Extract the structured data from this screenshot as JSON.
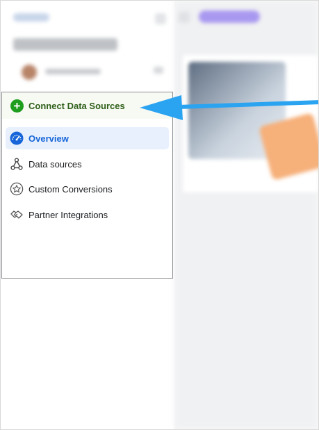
{
  "menu": {
    "connect_label": "Connect Data Sources",
    "items": [
      {
        "label": "Overview",
        "icon": "dashboard-icon",
        "active": true
      },
      {
        "label": "Data sources",
        "icon": "data-sources-icon",
        "active": false
      },
      {
        "label": "Custom Conversions",
        "icon": "star-circle-icon",
        "active": false
      },
      {
        "label": "Partner Integrations",
        "icon": "handshake-icon",
        "active": false
      }
    ]
  },
  "colors": {
    "connect_green": "#1f9d1f",
    "active_blue": "#1765d8",
    "arrow_blue": "#2aa3f0"
  }
}
